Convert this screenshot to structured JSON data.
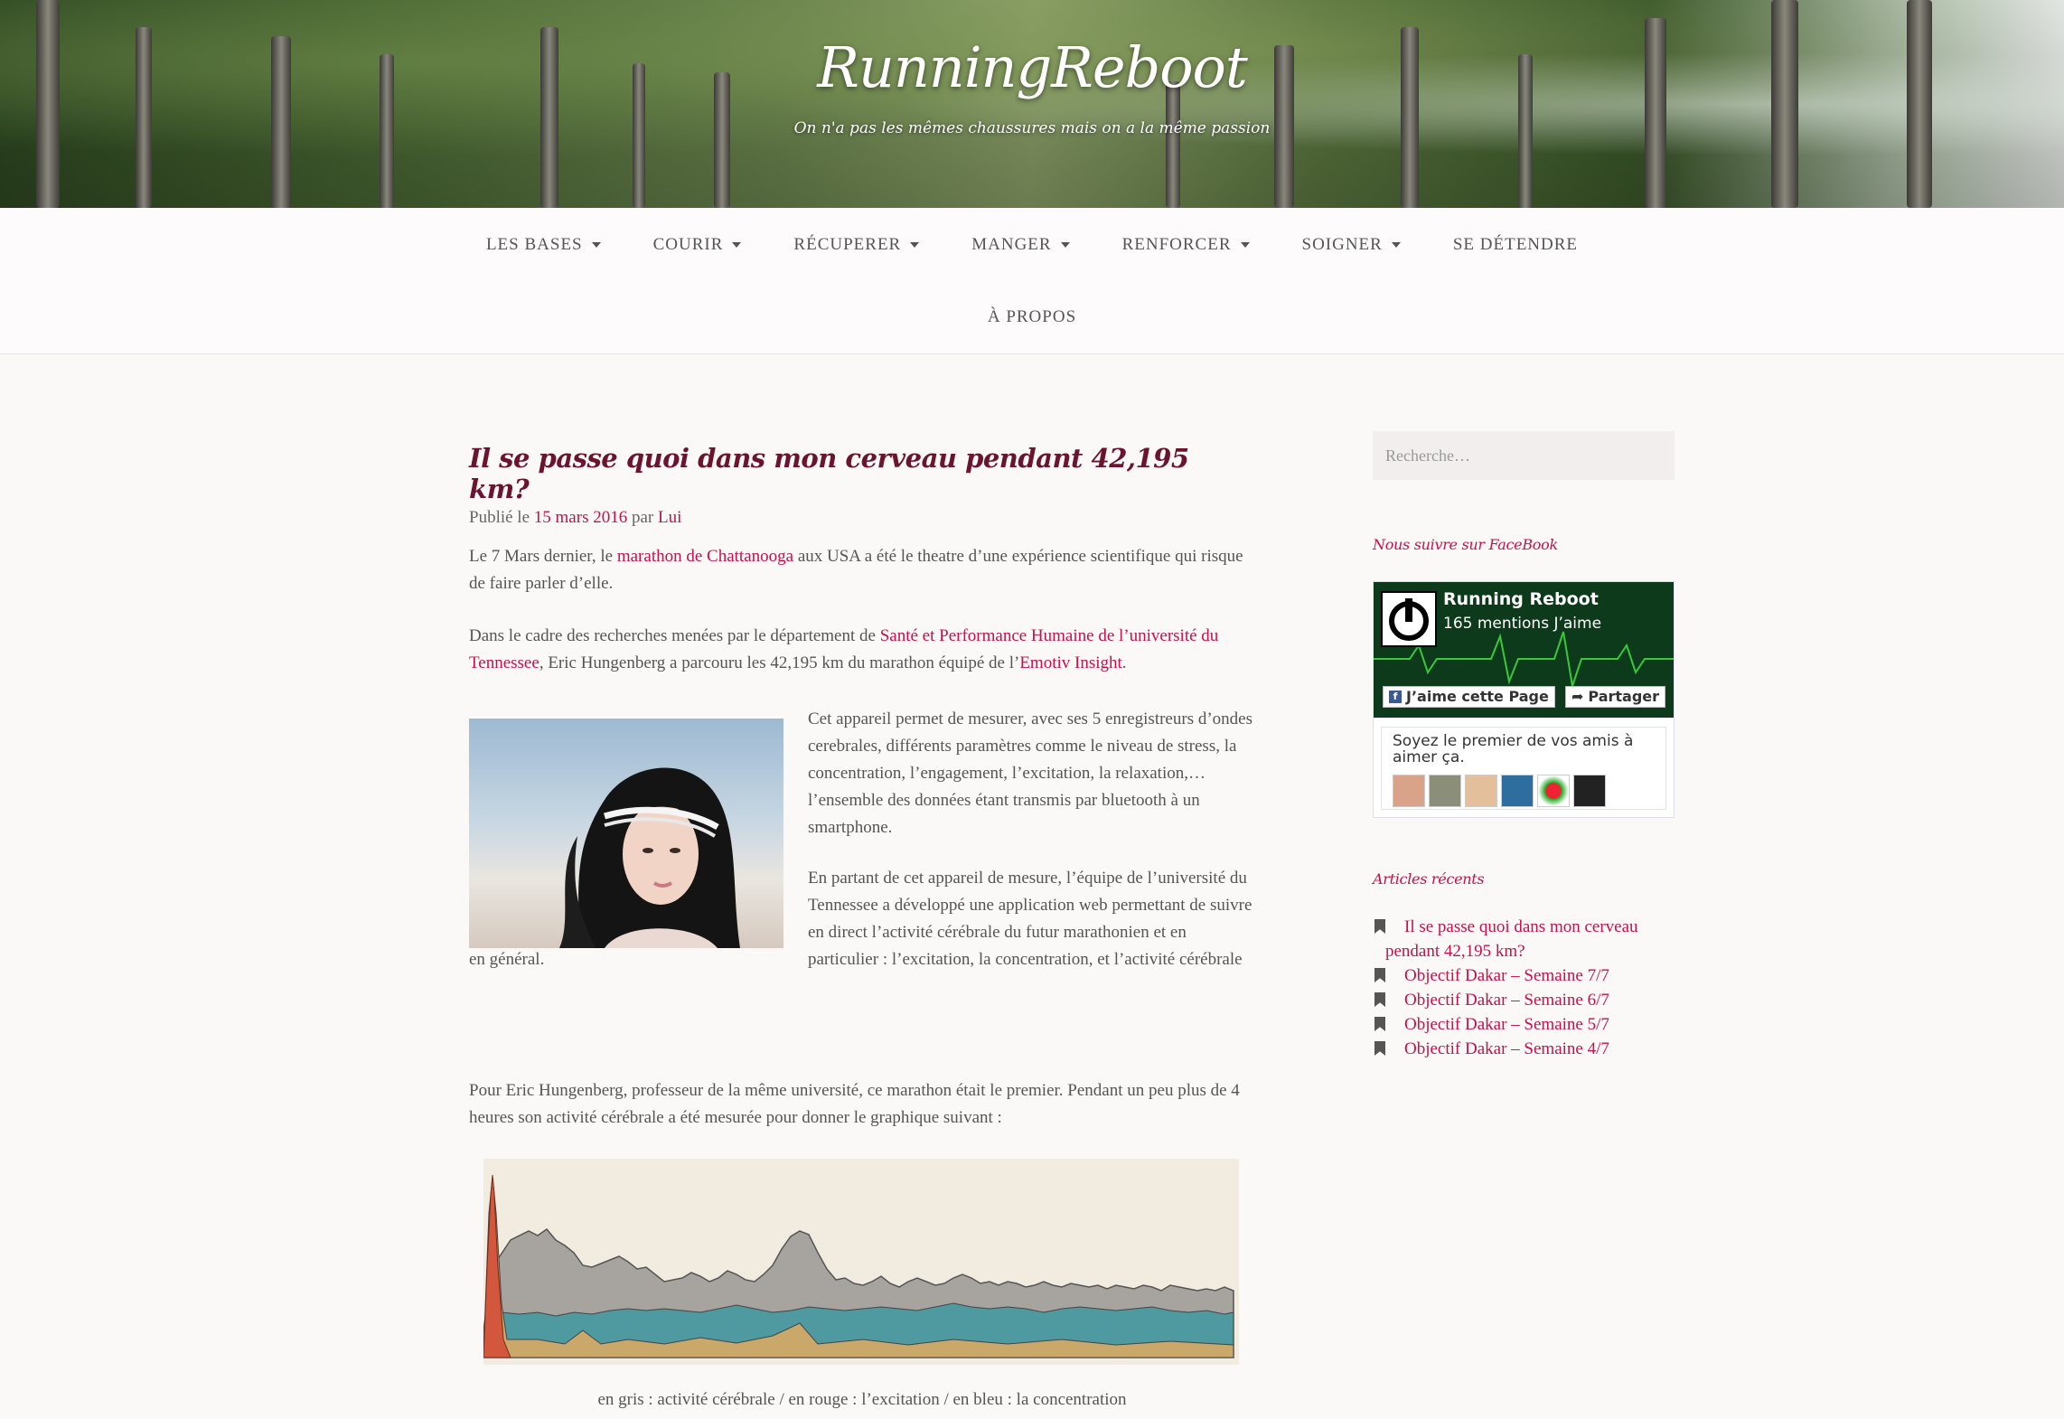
{
  "site": {
    "title": "RunningReboot",
    "description": "On n'a pas les mêmes chaussures mais on a la même passion"
  },
  "nav": {
    "row1": [
      {
        "label": "LES BASES",
        "has_submenu": true
      },
      {
        "label": "COURIR",
        "has_submenu": true
      },
      {
        "label": "RÉCUPERER",
        "has_submenu": true
      },
      {
        "label": "MANGER",
        "has_submenu": true
      },
      {
        "label": "RENFORCER",
        "has_submenu": true
      },
      {
        "label": "SOIGNER",
        "has_submenu": true
      },
      {
        "label": "SE DÉTENDRE",
        "has_submenu": false
      }
    ],
    "row2": [
      {
        "label": "À PROPOS",
        "has_submenu": false
      }
    ]
  },
  "post": {
    "title": "Il se passe quoi dans mon cerveau pendant 42,195 km?",
    "meta_published": "Publié le",
    "meta_date": "15 mars 2016",
    "meta_by": "par",
    "meta_author": "Lui",
    "p1_a": "Le 7 Mars dernier, le",
    "p1_link": "marathon de Chattanooga",
    "p1_b": "aux USA a été le theatre d’une expérience scientifique qui risque de faire parler d’elle.",
    "p2_a": "Dans le cadre des recherches menées par le département de",
    "p2_link1": "Santé et Performance Humaine de l’université du Tennessee",
    "p2_b": ", Eric Hungenberg a parcouru les 42,195 km du marathon équipé de l’",
    "p2_link2": "Emotiv Insight",
    "p2_c": ".",
    "p3": "Cet appareil permet de mesurer, avec ses 5 enregistreurs d’ondes cerebrales, différents paramètres comme le niveau de stress, la concentration, l’engagement, l’excitation, la relaxation,…l’ensemble des données étant transmis par bluetooth à un smartphone.",
    "p4": "En partant de cet appareil de mesure, l’équipe de l’université du Tennessee a développé une application web permettant de suivre en direct l’activité cérébrale du futur marathonien et en particulier : l’excitation, la concentration, et l’activité cérébrale",
    "p4_end": "en général.",
    "p5": "Pour Eric Hungenberg, professeur de la même université, ce marathon était le premier. Pendant un peu plus de 4 heures son activité cérébrale a été mesurée pour donner le graphique suivant :",
    "caption": "en gris : activité cérébrale / en rouge : l’excitation / en bleu : la concentration"
  },
  "sidebar": {
    "search_placeholder": "Recherche…",
    "facebook_title": "Nous suivre sur FaceBook",
    "fb_page_name": "Running Reboot",
    "fb_likes": "165 mentions J’aime",
    "fb_like_button": "J’aime cette Page",
    "fb_share_button": "Partager",
    "fb_friends_text": "Soyez le premier de vos amis à aimer ça.",
    "recent_title": "Articles récents",
    "recent": [
      {
        "line1": "Il se passe quoi dans mon cerveau",
        "line2": "pendant 42,195 km?"
      },
      {
        "line1": "Objectif Dakar – Semaine 7/7"
      },
      {
        "line1": "Objectif Dakar – Semaine 6/7"
      },
      {
        "line1": "Objectif Dakar – Semaine 5/7"
      },
      {
        "line1": "Objectif Dakar – Semaine 4/7"
      }
    ]
  },
  "colors": {
    "accent": "#c1134a",
    "title": "#6b1432",
    "chart_gray": "#9e9a97",
    "chart_red": "#c9543a",
    "chart_teal": "#3f8f96"
  }
}
